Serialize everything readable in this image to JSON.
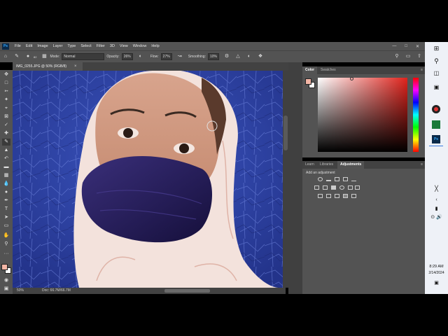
{
  "app": {
    "logo": "Ps",
    "menus": [
      "File",
      "Edit",
      "Image",
      "Layer",
      "Type",
      "Select",
      "Filter",
      "3D",
      "View",
      "Window",
      "Help"
    ]
  },
  "options_bar": {
    "mode_label": "Mode:",
    "mode_value": "Normal",
    "opacity_label": "Opacity:",
    "opacity_value": "26%",
    "flow_label": "Flow:",
    "flow_value": "27%",
    "smoothing_label": "Smoothing:",
    "smoothing_value": "10%",
    "brush_size": "82"
  },
  "document": {
    "tab_title": "IMG_0255.JPG @ 50% (RGB/8)",
    "zoom": "50%",
    "doc_info": "Doc: 66.7M/66.7M"
  },
  "color_panel": {
    "tabs": [
      "Color",
      "Swatches"
    ],
    "active_tab": "Color",
    "foreground": "#f2b5a5",
    "background": "#ffffff",
    "hue_color": "#e0231c"
  },
  "adjustments_panel": {
    "tabs": [
      "Learn",
      "Libraries",
      "Adjustments"
    ],
    "active_tab": "Adjustments",
    "heading": "Add an adjustment"
  },
  "taskbar": {
    "time": "8:29 AM",
    "date": "2/14/2024"
  }
}
